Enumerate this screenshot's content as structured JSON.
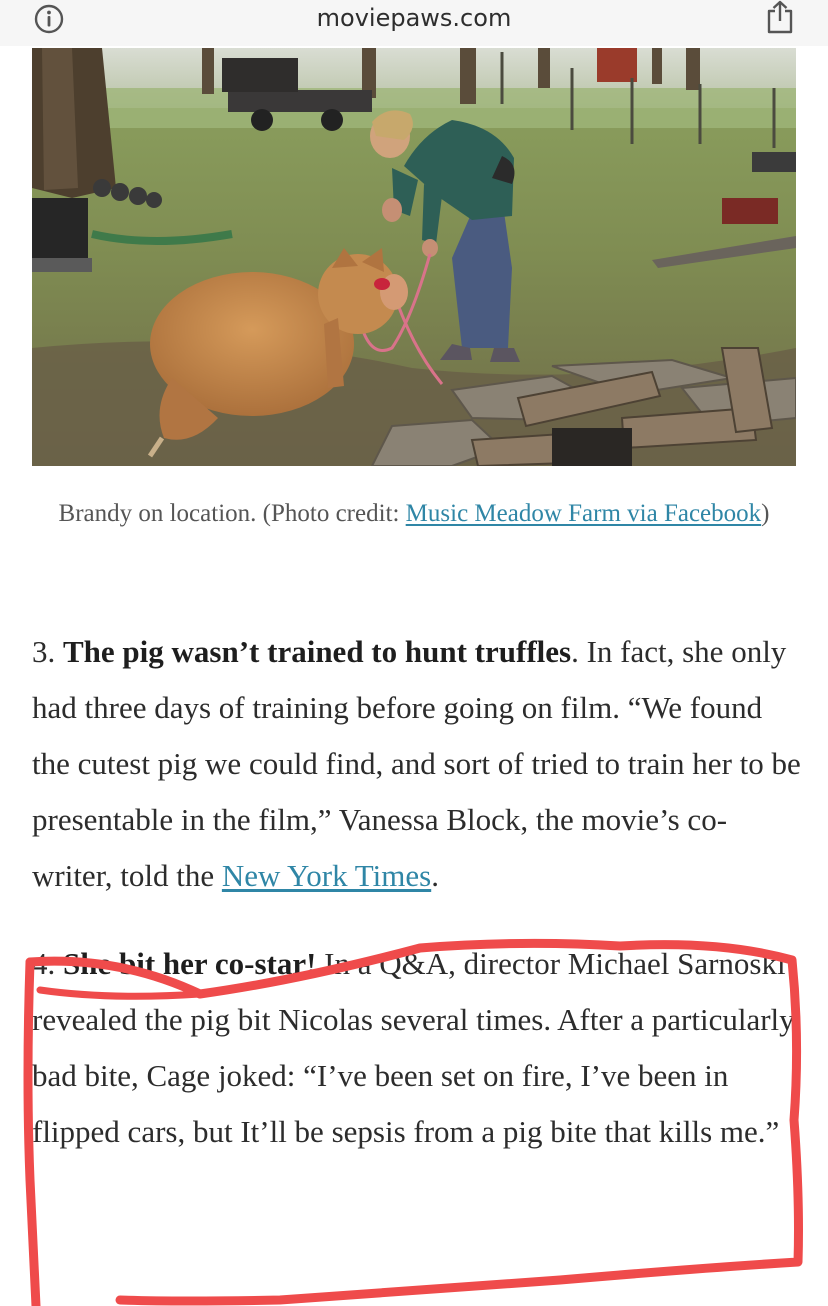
{
  "browser": {
    "url": "moviepaws.com",
    "info_icon": "info-circle-icon",
    "share_icon": "share-icon"
  },
  "photo": {
    "description_icon": "photo-pig-training"
  },
  "caption": {
    "text": "Brandy on location. (Photo credit: ",
    "link_text": "Music Meadow Farm via Facebook",
    "closing": ")"
  },
  "article": {
    "item3": {
      "number": "3. ",
      "heading": "The pig wasn’t trained to hunt truffles",
      "body": ". In fact, she only had three days of training before going on film. “We found the cutest pig we could find, and sort of tried to train her to be presentable in the film,” Vanessa Block, the movie’s co-writer, told the ",
      "link_text": "New York Times",
      "end": "."
    },
    "item4": {
      "number": "4. ",
      "heading": "She bit her co-star!",
      "body": " In a Q&A, director Michael Sarnoski revealed the pig bit Nicolas several times. After a particularly bad bite, Cage joked: “I’ve been set on fire, I’ve been in flipped cars, but It’ll be sepsis from a pig bite that kills me.”"
    }
  },
  "colors": {
    "link": "#2f86a6",
    "highlight": "#ef4b4b",
    "topbar": "#f6f6f6"
  }
}
